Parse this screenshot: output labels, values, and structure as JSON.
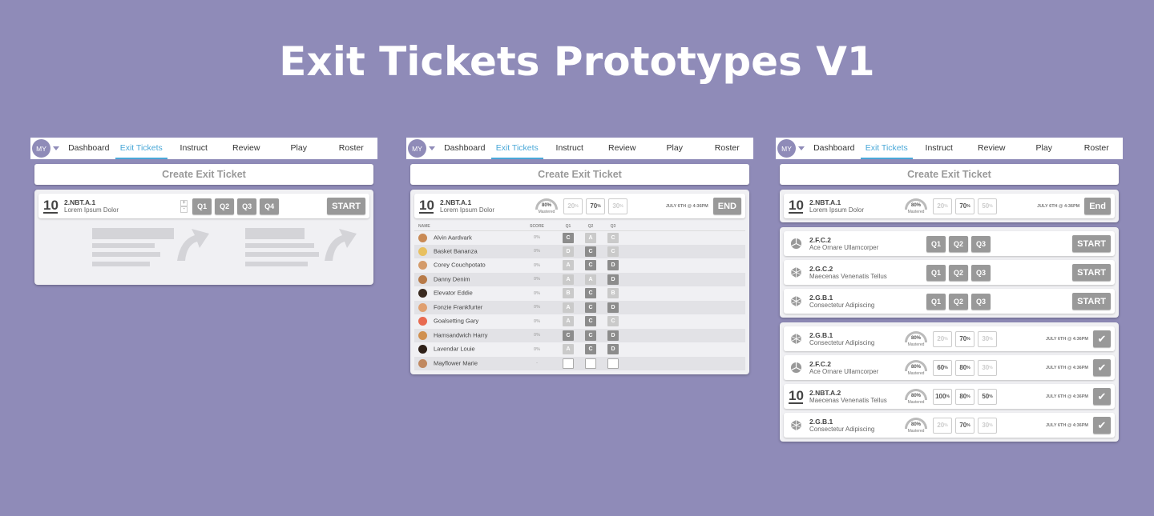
{
  "page_title": "Exit Tickets Prototypes V1",
  "nav": {
    "avatar": "MY",
    "items": [
      "Dashboard",
      "Exit Tickets",
      "Instruct",
      "Review",
      "Play",
      "Roster"
    ],
    "active": "Exit Tickets"
  },
  "create_label": "Create Exit Ticket",
  "p1": {
    "grade": "10",
    "code": "2.NBT.A.1",
    "desc": "Lorem Ipsum Dolor",
    "stepper_plus": "+",
    "stepper_minus": "-",
    "questions": [
      "Q1",
      "Q2",
      "Q3",
      "Q4"
    ],
    "start": "START"
  },
  "p2": {
    "grade": "10",
    "code": "2.NBT.A.1",
    "desc": "Lorem Ipsum Dolor",
    "gauge_value": "80%",
    "gauge_label": "Mastered",
    "pcts": [
      {
        "value": "20",
        "dim": true
      },
      {
        "value": "70",
        "dim": false
      },
      {
        "value": "30",
        "dim": true
      }
    ],
    "pct_unit": "%",
    "date": "JULY 6TH @ 4:36PM",
    "end": "END",
    "table_headers": [
      "NAME",
      "SCORE",
      "Q1",
      "Q2",
      "Q3"
    ],
    "students": [
      {
        "name": "Alvin Aardvark",
        "score": "0%",
        "grades": [
          [
            "C",
            "dark"
          ],
          [
            "A",
            "light"
          ],
          [
            "C",
            "light"
          ]
        ],
        "face": "#c98a55"
      },
      {
        "name": "Basket Bananza",
        "score": "0%",
        "grades": [
          [
            "D",
            "light"
          ],
          [
            "C",
            "dark"
          ],
          [
            "C",
            "light"
          ]
        ],
        "face": "#e8c060"
      },
      {
        "name": "Corey Couchpotato",
        "score": "0%",
        "grades": [
          [
            "A",
            "light"
          ],
          [
            "C",
            "dark"
          ],
          [
            "D",
            "dark"
          ]
        ],
        "face": "#d49b6a"
      },
      {
        "name": "Danny Denim",
        "score": "0%",
        "grades": [
          [
            "A",
            "light"
          ],
          [
            "A",
            "light"
          ],
          [
            "D",
            "dark"
          ]
        ],
        "face": "#b77a48"
      },
      {
        "name": "Elevator Eddie",
        "score": "0%",
        "grades": [
          [
            "B",
            "light"
          ],
          [
            "C",
            "dark"
          ],
          [
            "B",
            "light"
          ]
        ],
        "face": "#3a2a20"
      },
      {
        "name": "Fonzie Frankfurter",
        "score": "0%",
        "grades": [
          [
            "A",
            "light"
          ],
          [
            "C",
            "dark"
          ],
          [
            "D",
            "dark"
          ]
        ],
        "face": "#e0a070"
      },
      {
        "name": "Goalsetting Gary",
        "score": "0%",
        "grades": [
          [
            "A",
            "light"
          ],
          [
            "C",
            "dark"
          ],
          [
            "C",
            "light"
          ]
        ],
        "face": "#e86a50"
      },
      {
        "name": "Hamsandwich Harry",
        "score": "0%",
        "grades": [
          [
            "C",
            "dark"
          ],
          [
            "C",
            "dark"
          ],
          [
            "D",
            "dark"
          ]
        ],
        "face": "#d09050"
      },
      {
        "name": "Lavendar Louie",
        "score": "0%",
        "grades": [
          [
            "A",
            "light"
          ],
          [
            "C",
            "dark"
          ],
          [
            "D",
            "dark"
          ]
        ],
        "face": "#2e2018"
      },
      {
        "name": "Mayflower Marie",
        "score": "-",
        "grades": [
          [
            "",
            "empty"
          ],
          [
            "",
            "empty"
          ],
          [
            "",
            "empty"
          ]
        ],
        "face": "#c08860"
      }
    ]
  },
  "p3": {
    "active_ticket": {
      "grade": "10",
      "code": "2.NBT.A.1",
      "desc": "Lorem Ipsum Dolor",
      "gauge_value": "80%",
      "gauge_label": "Mastered",
      "pcts": [
        {
          "value": "20",
          "dim": true
        },
        {
          "value": "70",
          "dim": false
        },
        {
          "value": "50",
          "dim": true
        }
      ],
      "date": "JULY 6TH @ 4:36PM",
      "end": "End"
    },
    "ready": [
      {
        "icon": "pie-icon",
        "code": "2.F.C.2",
        "desc": "Ace Ornare Ullamcorper",
        "questions": [
          "Q1",
          "Q2",
          "Q3"
        ],
        "start": "START"
      },
      {
        "icon": "geometry-icon",
        "code": "2.G.C.2",
        "desc": "Maecenas Venenatis Tellus",
        "questions": [
          "Q1",
          "Q2",
          "Q3"
        ],
        "start": "START"
      },
      {
        "icon": "geometry-icon",
        "code": "2.G.B.1",
        "desc": "Consectetur Adipiscing",
        "questions": [
          "Q1",
          "Q2",
          "Q3"
        ],
        "start": "START"
      }
    ],
    "completed": [
      {
        "icon": "geometry-icon",
        "code": "2.G.B.1",
        "desc": "Consectetur Adipiscing",
        "gauge_value": "80%",
        "gauge_label": "Mastered",
        "pcts": [
          {
            "value": "20",
            "dim": true
          },
          {
            "value": "70",
            "dim": false
          },
          {
            "value": "30",
            "dim": true
          }
        ],
        "date": "JULY 6TH @ 4:36PM"
      },
      {
        "icon": "pie-icon",
        "code": "2.F.C.2",
        "desc": "Ace Ornare Ullamcorper",
        "gauge_value": "80%",
        "gauge_label": "Mastered",
        "pcts": [
          {
            "value": "60",
            "dim": false
          },
          {
            "value": "80",
            "dim": false
          },
          {
            "value": "30",
            "dim": true
          }
        ],
        "date": "JULY 6TH @ 4:36PM"
      },
      {
        "icon": "grade",
        "grade": "10",
        "code": "2.NBT.A.2",
        "desc": "Maecenas Venenatis Tellus",
        "gauge_value": "80%",
        "gauge_label": "Mastered",
        "pcts": [
          {
            "value": "100",
            "dim": false
          },
          {
            "value": "80",
            "dim": false
          },
          {
            "value": "50",
            "dim": false
          }
        ],
        "date": "JULY 6TH @ 4:36PM"
      },
      {
        "icon": "geometry-icon",
        "code": "2.G.B.1",
        "desc": "Consectetur Adipiscing",
        "gauge_value": "80%",
        "gauge_label": "Mastered",
        "pcts": [
          {
            "value": "20",
            "dim": true
          },
          {
            "value": "70",
            "dim": false
          },
          {
            "value": "30",
            "dim": true
          }
        ],
        "date": "JULY 6TH @ 4:36PM"
      }
    ]
  },
  "colors": {
    "background": "#8f8bb8",
    "accent": "#4aa8d8",
    "button": "#999999"
  }
}
